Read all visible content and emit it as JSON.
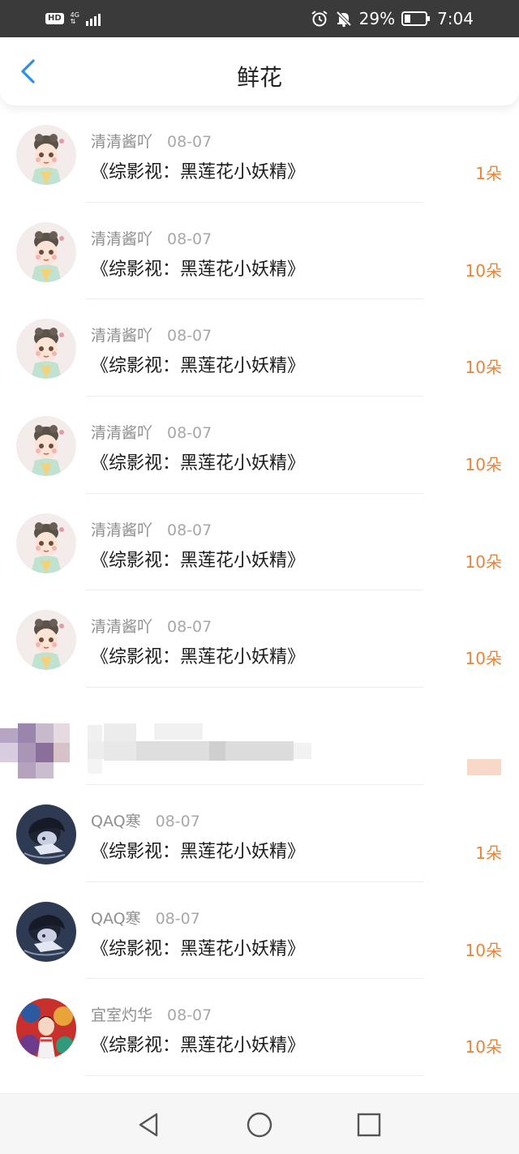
{
  "status_bar": {
    "hd": "HD",
    "network": "4G",
    "battery_percent": "29%",
    "time": "7:04"
  },
  "header": {
    "title": "鲜花",
    "back_icon": "chevron-left-icon"
  },
  "records": [
    {
      "user": "清清酱吖",
      "date": "08-07",
      "book": "《综影视：黑莲花小妖精》",
      "count": "1朵"
    },
    {
      "user": "清清酱吖",
      "date": "08-07",
      "book": "《综影视：黑莲花小妖精》",
      "count": "10朵"
    },
    {
      "user": "清清酱吖",
      "date": "08-07",
      "book": "《综影视：黑莲花小妖精》",
      "count": "10朵"
    },
    {
      "user": "清清酱吖",
      "date": "08-07",
      "book": "《综影视：黑莲花小妖精》",
      "count": "10朵"
    },
    {
      "user": "清清酱吖",
      "date": "08-07",
      "book": "《综影视：黑莲花小妖精》",
      "count": "10朵"
    },
    {
      "user": "清清酱吖",
      "date": "08-07",
      "book": "《综影视：黑莲花小妖精》",
      "count": "10朵"
    },
    {
      "user": "",
      "date": "",
      "book": "",
      "count": "",
      "pixelated": true
    },
    {
      "user": "QAQ寒",
      "date": "08-07",
      "book": "《综影视：黑莲花小妖精》",
      "count": "1朵"
    },
    {
      "user": "QAQ寒",
      "date": "08-07",
      "book": "《综影视：黑莲花小妖精》",
      "count": "10朵"
    },
    {
      "user": "宜室灼华",
      "date": "08-07",
      "book": "《综影视：黑莲花小妖精》",
      "count": "10朵"
    }
  ],
  "colors": {
    "count": "#e9833b",
    "accent": "#2f8fe6"
  },
  "nav_bar": {
    "back": "triangle-back-icon",
    "home": "circle-home-icon",
    "recents": "square-recents-icon"
  }
}
